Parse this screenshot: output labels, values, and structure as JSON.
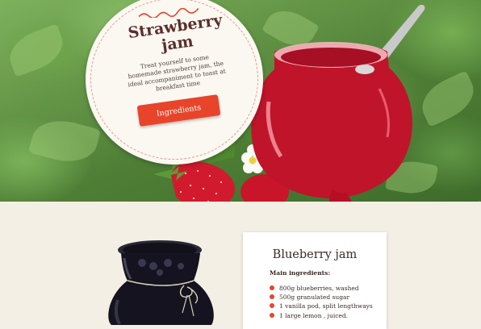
{
  "hero": {
    "title": "Strawberry jam",
    "description": "Treat yourself to some homemade strawberry jam, the ideal accompaniment to toast at breakfast time",
    "button_label": "Ingredients"
  },
  "blueberry": {
    "title": "Blueberry jam",
    "ingredients_heading": "Main ingredients:",
    "ingredients": [
      "800g blueberries, washed",
      "500g granulated sugar",
      "1 vanilla pod, split lengthways",
      "1 large lemon , juiced."
    ]
  },
  "colors": {
    "accent": "#e8442a",
    "title_text": "#5b2f2a",
    "paper": "#f4efe4",
    "strawberry": "#c8152a",
    "blueberry_jar": "#14131f"
  },
  "icons": [
    "wavy-line-icon",
    "bullet-dot-icon"
  ]
}
